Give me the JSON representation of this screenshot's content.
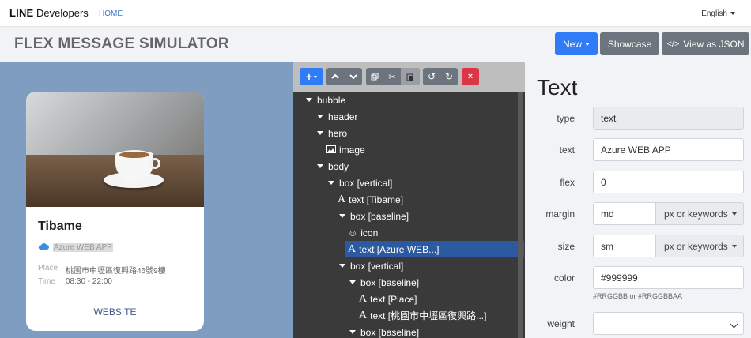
{
  "nav": {
    "brand_bold": "LINE",
    "brand_rest": " Developers",
    "home": "HOME",
    "language": "English"
  },
  "header": {
    "title": "FLEX MESSAGE SIMULATOR",
    "new_label": "New",
    "showcase_label": "Showcase",
    "view_json_label": "View as JSON"
  },
  "card": {
    "title": "Tibame",
    "app": "Azure WEB APP",
    "place_label": "Place",
    "place_value": "桃園市中壢區復興路46號9樓",
    "time_label": "Time",
    "time_value": "08:30 - 22:00",
    "website": "WEBSITE"
  },
  "toolbar": {
    "add": "+",
    "delete": "×"
  },
  "tree": {
    "items": [
      {
        "label": "bubble",
        "kind": "arrow"
      },
      {
        "label": "header",
        "kind": "arrow"
      },
      {
        "label": "hero",
        "kind": "arrow"
      },
      {
        "label": "image",
        "kind": "image-icon"
      },
      {
        "label": "body",
        "kind": "arrow"
      },
      {
        "label": "box [vertical]",
        "kind": "arrow"
      },
      {
        "label": "text [Tibame]",
        "kind": "text-icon"
      },
      {
        "label": "box [baseline]",
        "kind": "arrow"
      },
      {
        "label": "icon",
        "kind": "smile-icon"
      },
      {
        "label": "text [Azure WEB...]",
        "kind": "text-icon",
        "selected": true
      },
      {
        "label": "box [vertical]",
        "kind": "arrow"
      },
      {
        "label": "box [baseline]",
        "kind": "arrow"
      },
      {
        "label": "text [Place]",
        "kind": "text-icon"
      },
      {
        "label": "text [桃園市中壢區復興路...]",
        "kind": "text-icon"
      },
      {
        "label": "box [baseline]",
        "kind": "arrow"
      }
    ]
  },
  "props": {
    "title": "Text",
    "type_label": "type",
    "type_value": "text",
    "text_label": "text",
    "text_value": "Azure WEB APP",
    "flex_label": "flex",
    "flex_value": "0",
    "margin_label": "margin",
    "margin_value": "md",
    "margin_unit": "px or keywords",
    "size_label": "size",
    "size_value": "sm",
    "size_unit": "px or keywords",
    "color_label": "color",
    "color_value": "#999999",
    "color_hint": "#RRGGBB or #RRGGBBAA",
    "weight_label": "weight",
    "weight_value": ""
  },
  "colors": {
    "primary": "#2f7cf6",
    "secondary": "#6c757d",
    "danger": "#dc3545",
    "preview_bg": "#7f9dc0",
    "tree_bg": "#3a3a3a",
    "selected_row": "#2b5aa0"
  }
}
